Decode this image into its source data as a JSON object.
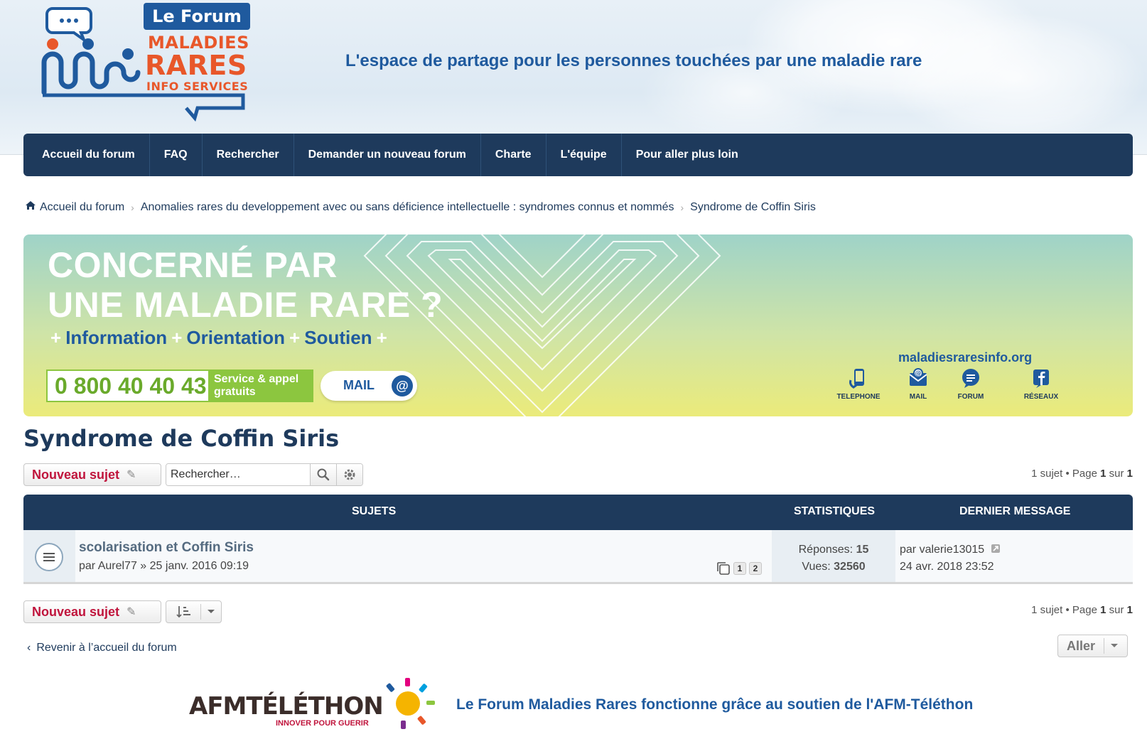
{
  "header": {
    "logo": {
      "box": "Le Forum",
      "line1": "MALADIES",
      "line2": "RARES",
      "line3": "INFO SERVICES"
    },
    "tagline": "L'espace de partage pour les personnes touchées par une maladie rare"
  },
  "nav": {
    "items": [
      "Accueil du forum",
      "FAQ",
      "Rechercher",
      "Demander un nouveau forum",
      "Charte",
      "L'équipe",
      "Pour aller plus loin"
    ]
  },
  "breadcrumb": {
    "items": [
      "Accueil du forum",
      "Anomalies rares du developpement avec ou sans déficience intellectuelle : syndromes connus et nommés",
      "Syndrome de Coffin Siris"
    ]
  },
  "banner": {
    "title1": "CONCERNÉ PAR",
    "title2": "UNE MALADIE RARE ?",
    "sub": [
      "Information",
      "Orientation",
      "Soutien"
    ],
    "plus": "+",
    "phone": "0 800 40 40 43",
    "phone_tag_l1": "Service & appel",
    "phone_tag_l2": "gratuits",
    "mail_label": "MAIL",
    "mail_at": "@",
    "site_url": "maladiesraresinfo.org",
    "icons": [
      {
        "label": "TELEPHONE",
        "icon": "phone-icon"
      },
      {
        "label": "MAIL",
        "icon": "mail-icon"
      },
      {
        "label": "FORUM",
        "icon": "forum-icon"
      },
      {
        "label": "RÉSEAUX",
        "icon": "facebook-icon"
      }
    ]
  },
  "page": {
    "title": "Syndrome de Coffin Siris"
  },
  "actions": {
    "new_topic": "Nouveau sujet",
    "search_placeholder": "Rechercher…",
    "pagination": {
      "count": "1 sujet",
      "sep": "•",
      "page_word": "Page",
      "page": "1",
      "of": "sur",
      "total": "1"
    },
    "go_label": "Aller",
    "back_link": "Revenir à l’accueil du forum"
  },
  "table": {
    "headers": {
      "topics": "SUJETS",
      "stats": "STATISTIQUES",
      "last": "DERNIER MESSAGE"
    },
    "rows": [
      {
        "title": "scolarisation et Coffin Siris",
        "by": "par",
        "author": "Aurel77",
        "date": "» 25 janv. 2016 09:19",
        "pages": [
          "1",
          "2"
        ],
        "replies_label": "Réponses:",
        "replies": "15",
        "views_label": "Vues:",
        "views": "32560",
        "last_by": "par",
        "last_author": "valerie13015",
        "last_date": "24 avr. 2018 23:52"
      }
    ]
  },
  "footer": {
    "afm_name": "AFMTÉLÉTHON",
    "afm_sub": "INNOVER POUR GUERIR",
    "text": "Le Forum Maladies Rares fonctionne grâce au soutien de l'AFM-Téléthon"
  },
  "colors": {
    "navy": "#1e3a5c",
    "brand_blue": "#1f5a9e",
    "accent_red": "#c0143c",
    "orange": "#e8572a",
    "green": "#8cc63f"
  }
}
